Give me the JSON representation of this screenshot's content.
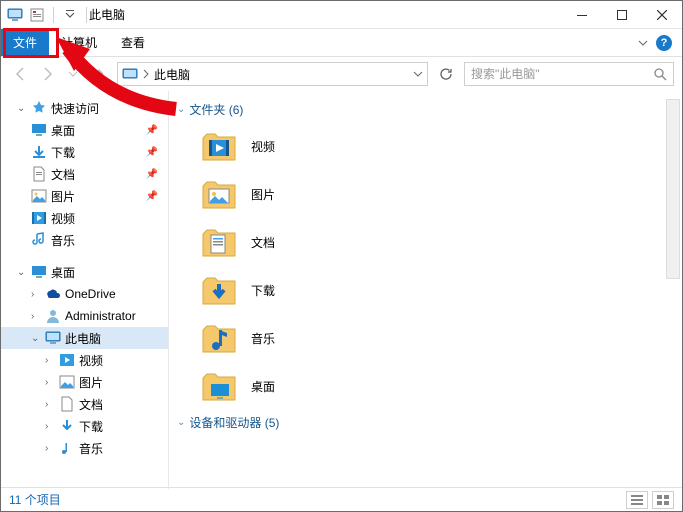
{
  "titlebar": {
    "title": "此电脑"
  },
  "ribbon": {
    "file": "文件",
    "computer": "计算机",
    "view": "查看"
  },
  "address": {
    "crumb": "此电脑"
  },
  "search": {
    "placeholder": "搜索\"此电脑\""
  },
  "sidebar": {
    "quick_access": "快速访问",
    "desktop": "桌面",
    "downloads": "下载",
    "documents": "文档",
    "pictures": "图片",
    "videos": "视频",
    "music": "音乐",
    "desktop2": "桌面",
    "onedrive": "OneDrive",
    "administrator": "Administrator",
    "this_pc": "此电脑",
    "tp_videos": "视频",
    "tp_pictures": "图片",
    "tp_documents": "文档",
    "tp_downloads": "下载",
    "tp_music": "音乐"
  },
  "main": {
    "folders_header": "文件夹 (6)",
    "videos": "视频",
    "pictures": "图片",
    "documents": "文档",
    "downloads": "下载",
    "music": "音乐",
    "desktop": "桌面",
    "devices_header": "设备和驱动器 (5)"
  },
  "statusbar": {
    "count": "11 个项目"
  }
}
